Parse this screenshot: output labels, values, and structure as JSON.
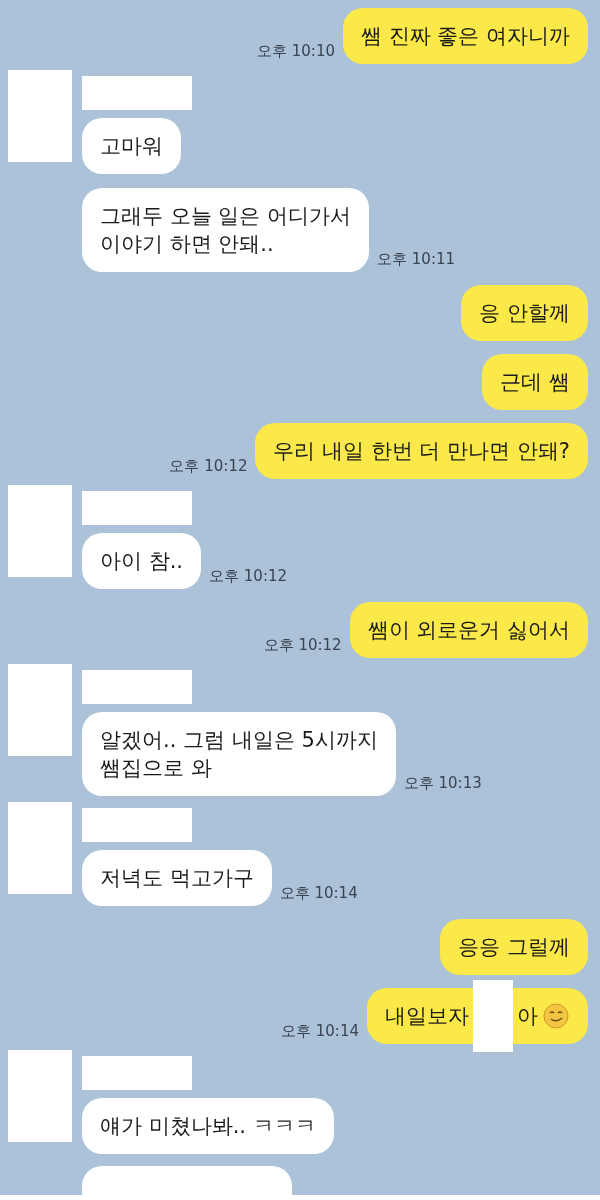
{
  "messages": [
    {
      "kind": "sent",
      "text": "쌤 진짜 좋은 여자니까",
      "time": "오후 10:10"
    },
    {
      "kind": "received",
      "texts": [
        "고마워",
        "그래두 오늘 일은 어디가서\n이야기 하면 안돼.."
      ],
      "time": "오후 10:11"
    },
    {
      "kind": "sent",
      "text": "응 안할께"
    },
    {
      "kind": "sent",
      "text": "근데 쌤"
    },
    {
      "kind": "sent",
      "text": "우리 내일 한번 더 만나면 안돼?",
      "time": "오후 10:12"
    },
    {
      "kind": "received",
      "texts": [
        "아이 참.."
      ],
      "time": "오후 10:12"
    },
    {
      "kind": "sent",
      "text": "쌤이 외로운거 싫어서",
      "time": "오후 10:12"
    },
    {
      "kind": "received",
      "texts": [
        "알겠어.. 그럼 내일은 5시까지\n쌤집으로 와"
      ],
      "time": "오후 10:13"
    },
    {
      "kind": "received",
      "texts": [
        "저녁도 먹고가구"
      ],
      "time": "오후 10:14"
    },
    {
      "kind": "sent",
      "text": "응응 그럴께"
    },
    {
      "kind": "sent_redacted",
      "text": "내일보자",
      "text_after": "아",
      "time": "오후 10:14"
    },
    {
      "kind": "received",
      "texts": [
        "얘가 미쳤나봐.. ㅋㅋㅋ"
      ]
    },
    {
      "kind": "partial"
    }
  ]
}
